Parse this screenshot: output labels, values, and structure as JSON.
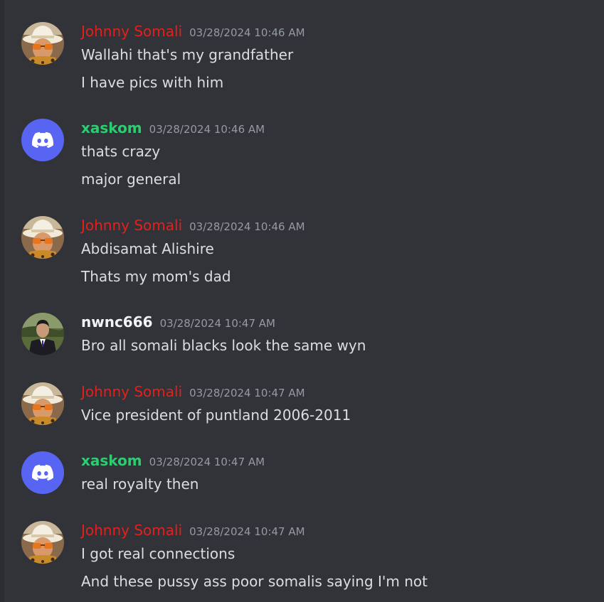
{
  "messages": [
    {
      "author": "Johnny Somali",
      "author_color": "#e5201c",
      "avatar": "hat-sunglasses-avatar",
      "timestamp": "03/28/2024 10:46 AM",
      "lines": [
        "Wallahi that's my grandfather",
        "I have pics with him"
      ]
    },
    {
      "author": "xaskom",
      "author_color": "#2ecc71",
      "avatar": "discord-logo-icon",
      "timestamp": "03/28/2024 10:46 AM",
      "lines": [
        "thats crazy",
        "major general"
      ]
    },
    {
      "author": "Johnny Somali",
      "author_color": "#e5201c",
      "avatar": "hat-sunglasses-avatar",
      "timestamp": "03/28/2024 10:46 AM",
      "lines": [
        "Abdisamat Alishire",
        "Thats my mom's dad"
      ]
    },
    {
      "author": "nwnc666",
      "author_color": "#f2f3f5",
      "avatar": "suit-man-avatar",
      "timestamp": "03/28/2024 10:47 AM",
      "lines": [
        "Bro all somali blacks look the same wyn"
      ]
    },
    {
      "author": "Johnny Somali",
      "author_color": "#e5201c",
      "avatar": "hat-sunglasses-avatar",
      "timestamp": "03/28/2024 10:47 AM",
      "lines": [
        "Vice president of puntland 2006-2011"
      ]
    },
    {
      "author": "xaskom",
      "author_color": "#2ecc71",
      "avatar": "discord-logo-icon",
      "timestamp": "03/28/2024 10:47 AM",
      "lines": [
        "real royalty then"
      ]
    },
    {
      "author": "Johnny Somali",
      "author_color": "#e5201c",
      "avatar": "hat-sunglasses-avatar",
      "timestamp": "03/28/2024 10:47 AM",
      "lines": [
        "I got real connections",
        "And these pussy ass poor somalis saying I'm not"
      ]
    }
  ]
}
